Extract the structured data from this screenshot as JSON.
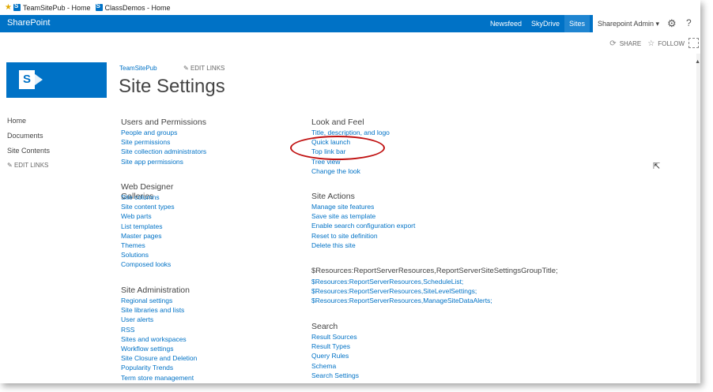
{
  "bookmarks": [
    {
      "label": "TeamSitePub - Home"
    },
    {
      "label": "ClassDemos - Home"
    }
  ],
  "suitebar": {
    "brand": "SharePoint",
    "nav": [
      "Newsfeed",
      "SkyDrive",
      "Sites"
    ],
    "user": "Sharepoint Admin ▾"
  },
  "actions": {
    "share": "SHARE",
    "follow": "FOLLOW"
  },
  "breadcrumb": "TeamSitePub",
  "edit_links": "EDIT LINKS",
  "page_title": "Site Settings",
  "left_nav": [
    "Home",
    "Documents",
    "Site Contents"
  ],
  "sections_left": [
    {
      "title": "Users and Permissions",
      "links": [
        "People and groups",
        "Site permissions",
        "Site collection administrators",
        "Site app permissions"
      ]
    },
    {
      "title": "Web Designer Galleries",
      "links": [
        "Site columns",
        "Site content types",
        "Web parts",
        "List templates",
        "Master pages",
        "Themes",
        "Solutions",
        "Composed looks"
      ]
    },
    {
      "title": "Site Administration",
      "links": [
        "Regional settings",
        "Site libraries and lists",
        "User alerts",
        "RSS",
        "Sites and workspaces",
        "Workflow settings",
        "Site Closure and Deletion",
        "Popularity Trends",
        "Term store management"
      ]
    }
  ],
  "sections_right": [
    {
      "title": "Look and Feel",
      "links": [
        "Title, description, and logo",
        "Quick launch",
        "Top link bar",
        "Tree view",
        "Change the look"
      ]
    },
    {
      "title": "Site Actions",
      "links": [
        "Manage site features",
        "Save site as template",
        "Enable search configuration export",
        "Reset to site definition",
        "Delete this site"
      ]
    },
    {
      "title": "$Resources:ReportServerResources,ReportServerSiteSettingsGroupTitle;",
      "links": [
        "$Resources:ReportServerResources,ScheduleList;",
        "$Resources:ReportServerResources,SiteLevelSettings;",
        "$Resources:ReportServerResources,ManageSiteDataAlerts;"
      ]
    },
    {
      "title": "Search",
      "links": [
        "Result Sources",
        "Result Types",
        "Query Rules",
        "Schema",
        "Search Settings"
      ]
    }
  ],
  "colors": {
    "brand": "#0072c6",
    "link": "#0072c6",
    "highlight": "#c01010"
  }
}
